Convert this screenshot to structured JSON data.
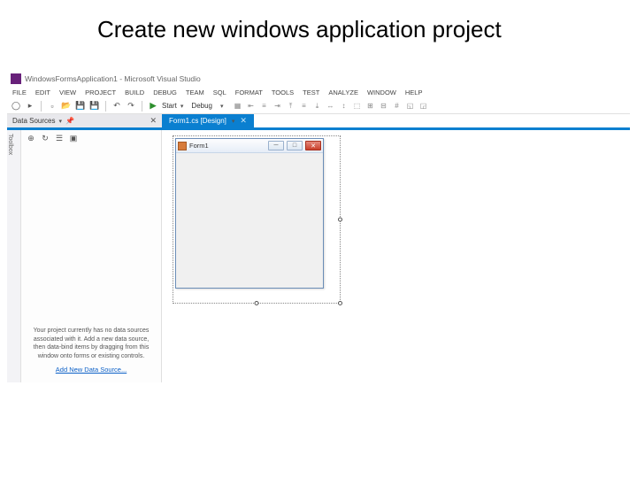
{
  "slide": {
    "title": "Create new windows application project"
  },
  "window": {
    "title": "WindowsFormsApplication1 - Microsoft Visual Studio"
  },
  "menu": [
    "FILE",
    "EDIT",
    "VIEW",
    "PROJECT",
    "BUILD",
    "DEBUG",
    "TEAM",
    "SQL",
    "FORMAT",
    "TOOLS",
    "TEST",
    "ANALYZE",
    "WINDOW",
    "HELP"
  ],
  "toolbar": {
    "start_label": "Start",
    "config_label": "Debug"
  },
  "sidebar": {
    "panel_title": "Data Sources",
    "vtab_label": "Toolbox",
    "message": "Your project currently has no data sources associated with it. Add a new data source, then data-bind items by dragging from this window onto forms or existing controls.",
    "link_label": "Add New Data Source..."
  },
  "tabs": {
    "active": "Form1.cs [Design]"
  },
  "form": {
    "title": "Form1",
    "min": "─",
    "max": "□",
    "close": "✕"
  }
}
